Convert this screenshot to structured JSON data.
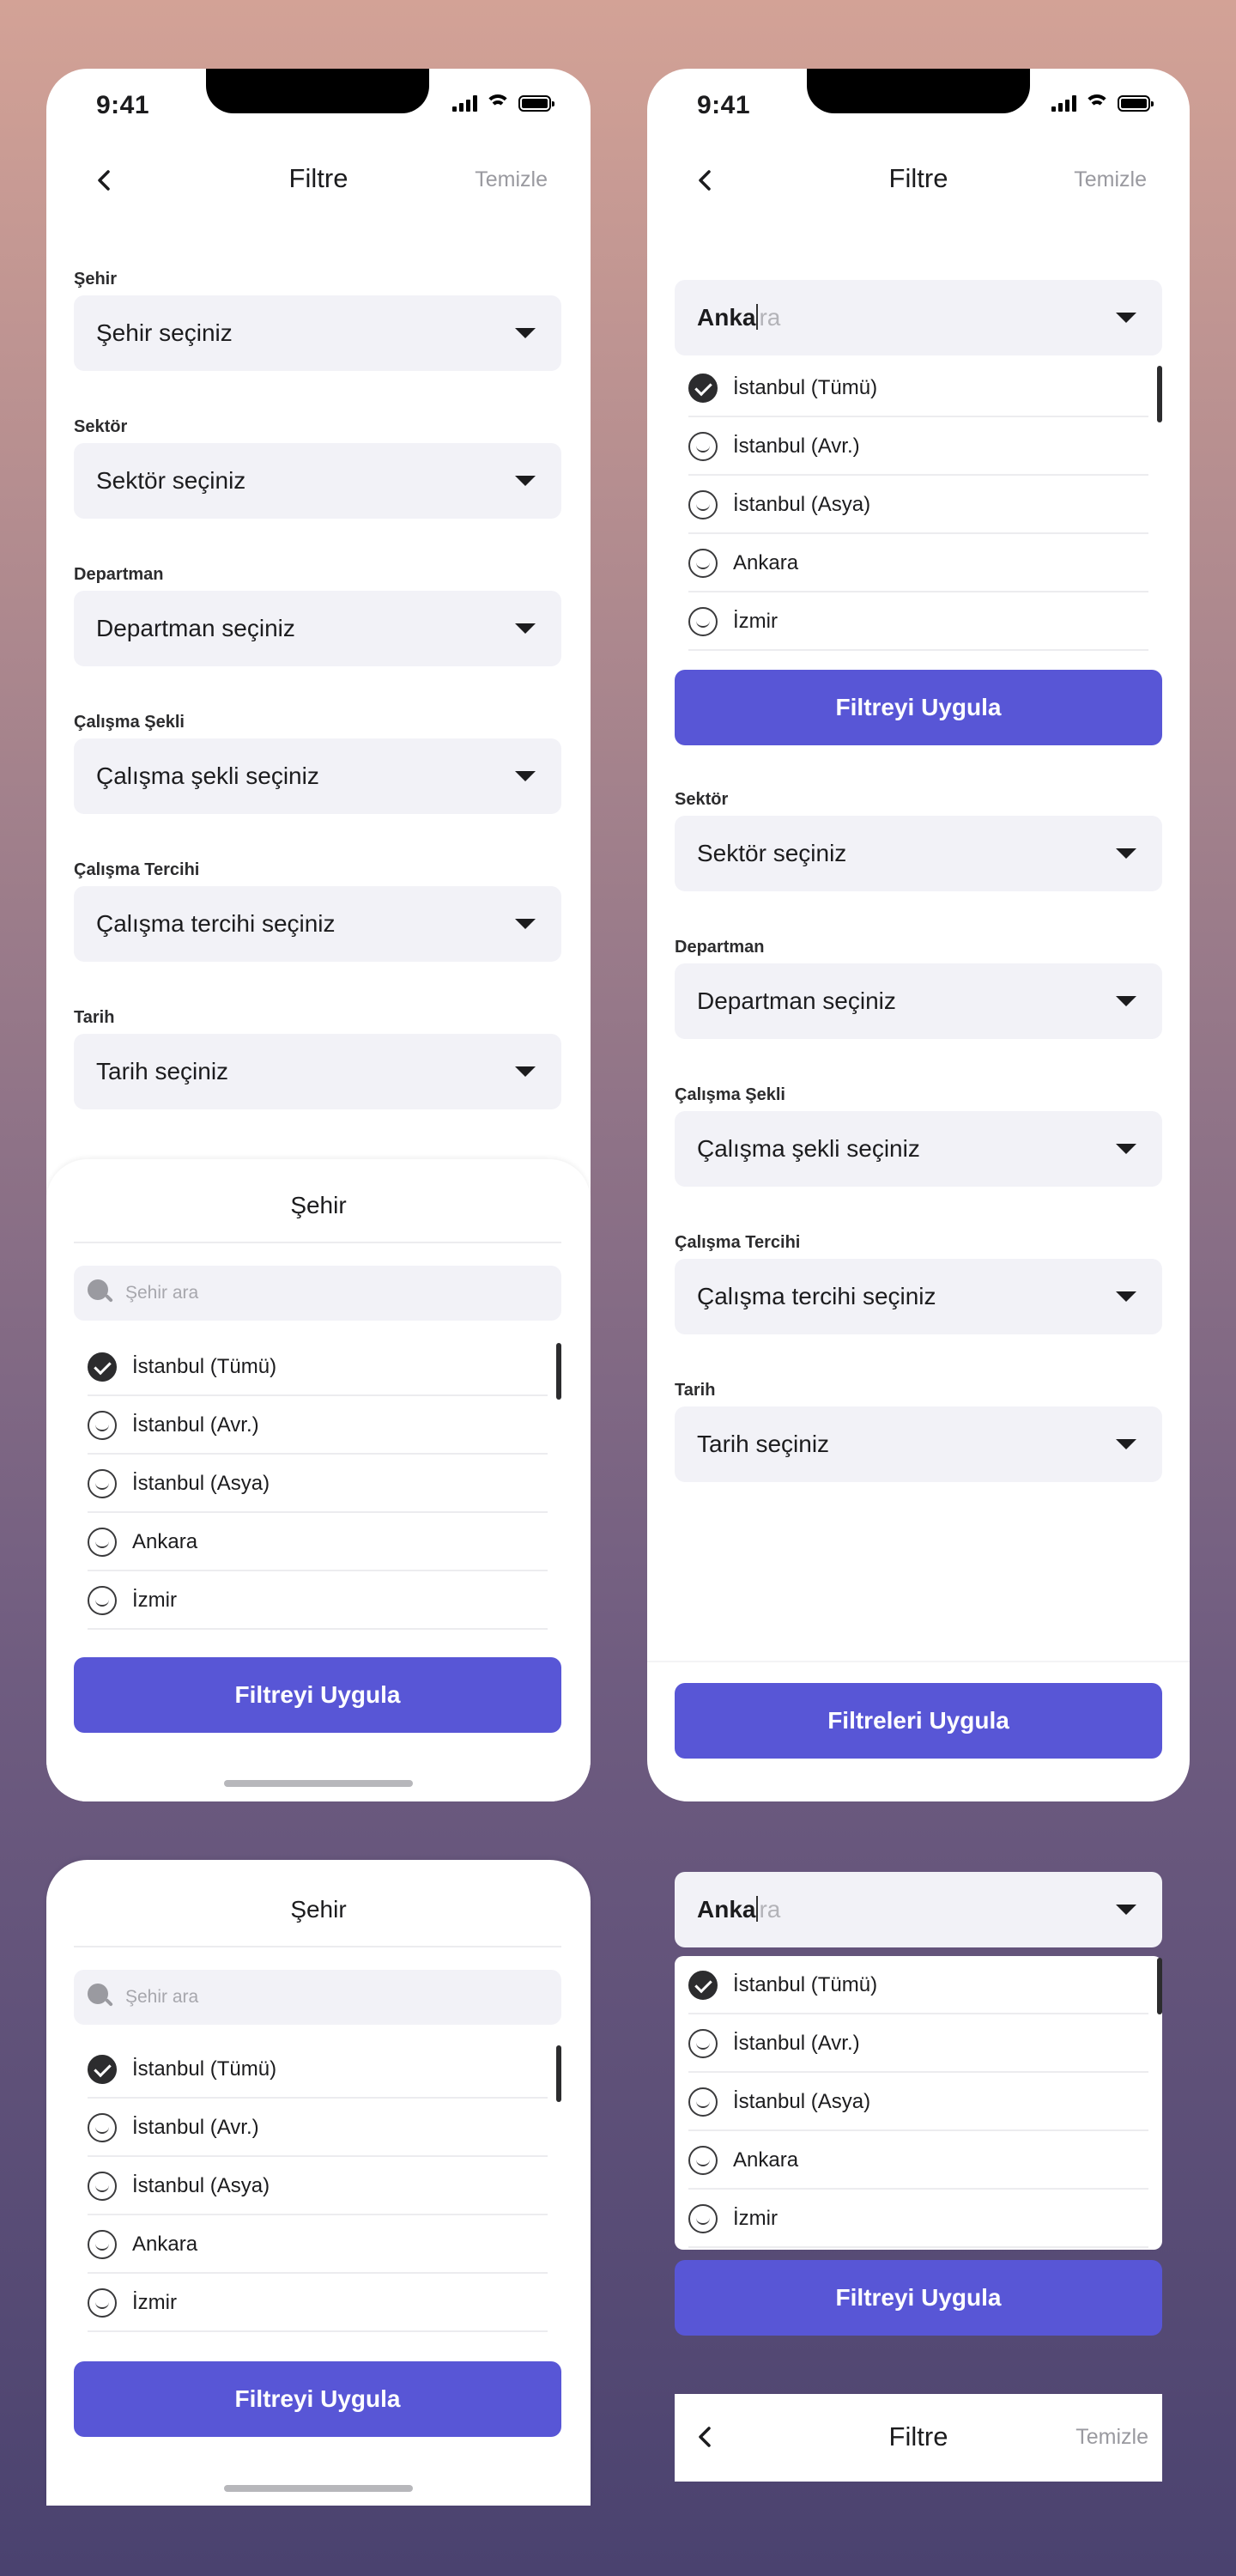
{
  "status": {
    "time": "9:41"
  },
  "nav": {
    "title": "Filtre",
    "clear": "Temizle"
  },
  "fields": [
    {
      "label": "Şehir",
      "placeholder": "Şehir seçiniz"
    },
    {
      "label": "Sektör",
      "placeholder": "Sektör seçiniz"
    },
    {
      "label": "Departman",
      "placeholder": "Departman seçiniz"
    },
    {
      "label": "Çalışma Şekli",
      "placeholder": "Çalışma şekli seçiniz"
    },
    {
      "label": "Çalışma Tercihi",
      "placeholder": "Çalışma tercihi seçiniz"
    },
    {
      "label": "Tarih",
      "placeholder": "Tarih seçiniz"
    }
  ],
  "sheet": {
    "title": "Şehir",
    "search_placeholder": "Şehir ara",
    "apply": "Filtreyi Uygula"
  },
  "options": [
    {
      "label": "İstanbul (Tümü)",
      "checked": true
    },
    {
      "label": "İstanbul (Avr.)",
      "checked": false
    },
    {
      "label": "İstanbul (Asya)",
      "checked": false
    },
    {
      "label": "Ankara",
      "checked": false
    },
    {
      "label": "İzmir",
      "checked": false
    }
  ],
  "city_input": {
    "typed": "Anka",
    "suggestion": "ra"
  },
  "apply_all": "Filtreleri Uygula"
}
